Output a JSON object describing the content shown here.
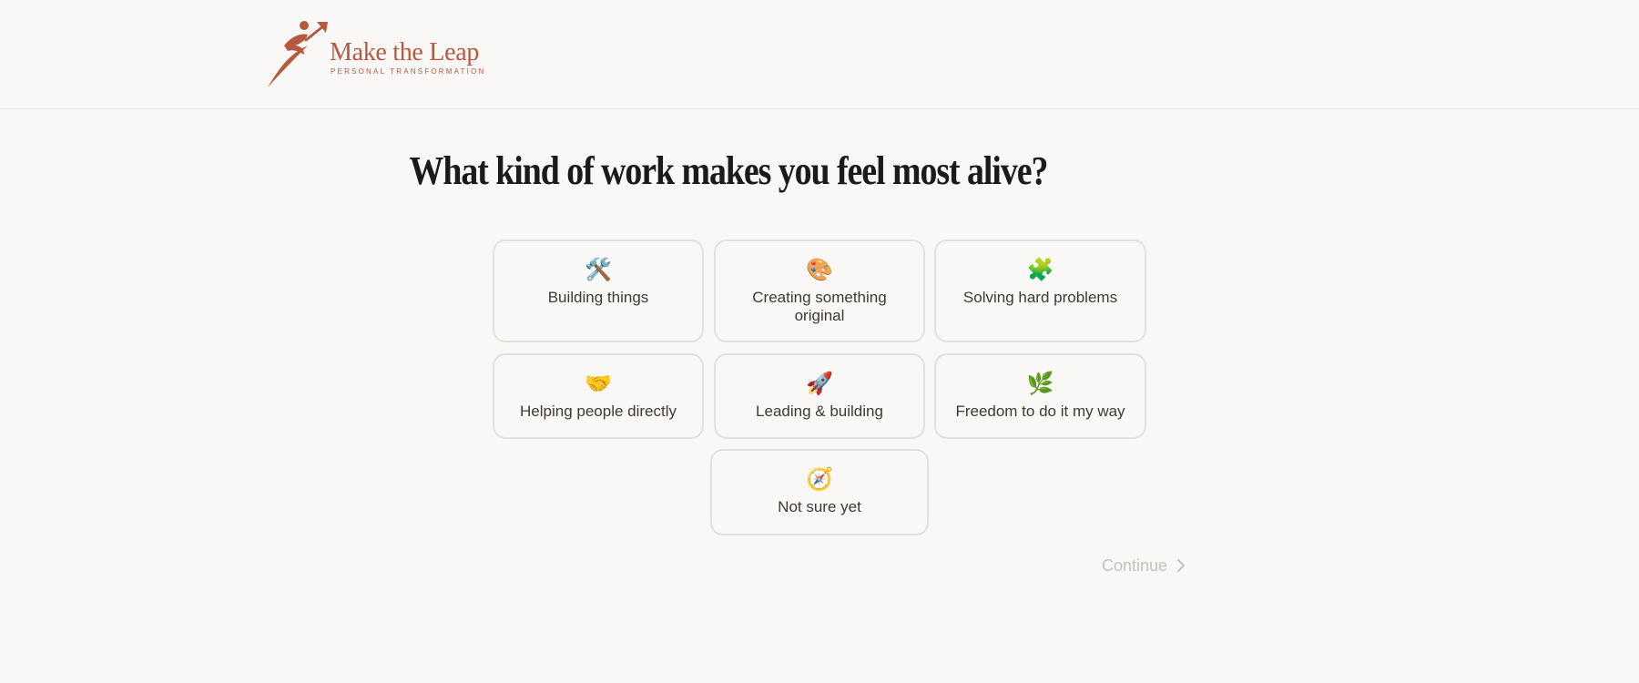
{
  "brand": {
    "name": "Make the Leap",
    "tagline": "PERSONAL TRANSFORMATION",
    "color": "#b65a3f"
  },
  "question": "What kind of work makes you feel most alive?",
  "options": [
    {
      "emoji": "🛠️",
      "icon": "hammer-wrench-icon",
      "label": "Building things"
    },
    {
      "emoji": "🎨",
      "icon": "palette-icon",
      "label": "Creating something original"
    },
    {
      "emoji": "🧩",
      "icon": "puzzle-piece-icon",
      "label": "Solving hard problems"
    },
    {
      "emoji": "🤝",
      "icon": "handshake-icon",
      "label": "Helping people directly"
    },
    {
      "emoji": "🚀",
      "icon": "rocket-icon",
      "label": "Leading & building"
    },
    {
      "emoji": "🌿",
      "icon": "herb-icon",
      "label": "Freedom to do it my way"
    },
    {
      "emoji": "🧭",
      "icon": "compass-icon",
      "label": "Not sure yet"
    }
  ],
  "continue_label": "Continue",
  "colors": {
    "background": "#f9f8f6",
    "card_border": "#e3e1dd",
    "text": "#3d3a36",
    "disabled": "#c4c2be"
  }
}
